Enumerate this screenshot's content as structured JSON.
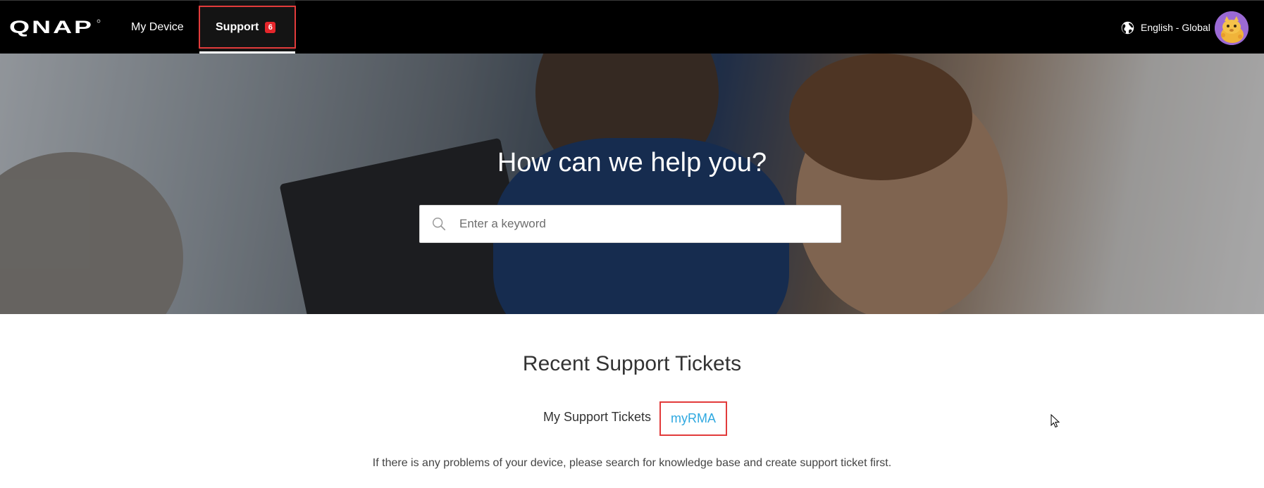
{
  "brand": {
    "name": "QNAP"
  },
  "nav": {
    "my_device": "My Device",
    "support": "Support",
    "support_badge": "6",
    "language": "English - Global"
  },
  "hero": {
    "title": "How can we help you?",
    "search_placeholder": "Enter a keyword"
  },
  "tickets": {
    "title": "Recent Support Tickets",
    "tab_tickets": "My Support Tickets",
    "tab_rma": "myRMA",
    "info": "If there is any problems of your device, please search for knowledge base and create support ticket first."
  },
  "colors": {
    "nav_bg": "#000000",
    "highlight": "#e23b3b",
    "badge": "#e5262b",
    "link": "#2ea8e0"
  },
  "icons": [
    "qnap-logo",
    "globe-icon",
    "search-icon",
    "avatar",
    "mouse-cursor"
  ]
}
